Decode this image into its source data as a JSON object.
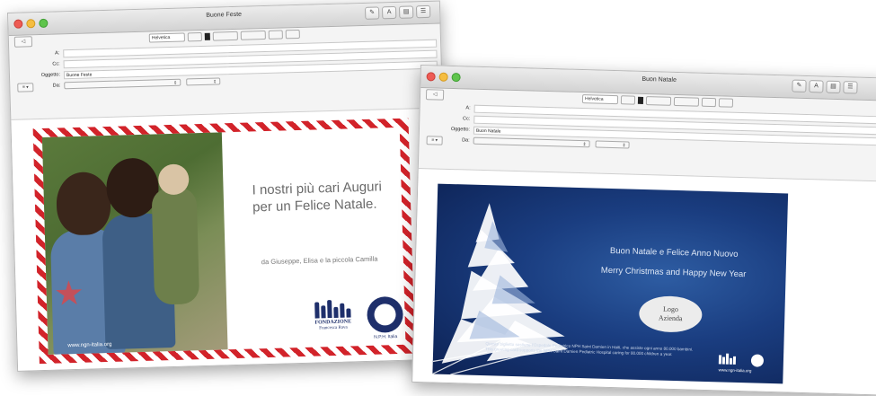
{
  "window1": {
    "title": "Buone Feste",
    "format": {
      "font": "Helvetica"
    },
    "headers": {
      "to_label": "A:",
      "cc_label": "Cc:",
      "subject_label": "Oggetto:",
      "subject_value": "Buone Feste",
      "from_label": "Da:"
    },
    "card": {
      "greeting": "I nostri più cari Auguri per un Felice Natale.",
      "signed": "da Giuseppe, Elisa e la piccola Camilla",
      "photo_url": "www.ngn-italia.org",
      "logo1_name": "FONDAZIONE",
      "logo1_sub": "Francesca Rava",
      "logo2_name": "N.P.H. Italia"
    }
  },
  "window2": {
    "title": "Buon Natale",
    "format": {
      "font": "Helvetica"
    },
    "headers": {
      "to_label": "A:",
      "cc_label": "Cc:",
      "subject_label": "Oggetto:",
      "subject_value": "Buon Natale",
      "from_label": "Da:"
    },
    "card": {
      "line1": "Buon Natale e Felice Anno Nuovo",
      "line2": "Merry Christmas and Happy New Year",
      "logo_line1": "Logo",
      "logo_line2": "Azienda",
      "fine_print_it": "Questo biglietto sostiene l'Ospedale Pediatrico NPH Saint Damien in Haiti, che assiste ogni anno 80.000 bambini.",
      "fine_print_en": "This greeting card supports the NPH Saint Damien Pediatric Hospital caring for 80.000 children a year.",
      "url": "www.ngn-italia.org"
    }
  },
  "colors": {
    "stripe_red": "#d2232a",
    "card_blue": "#1a3d80",
    "navy_logo": "#1e2f6b"
  }
}
